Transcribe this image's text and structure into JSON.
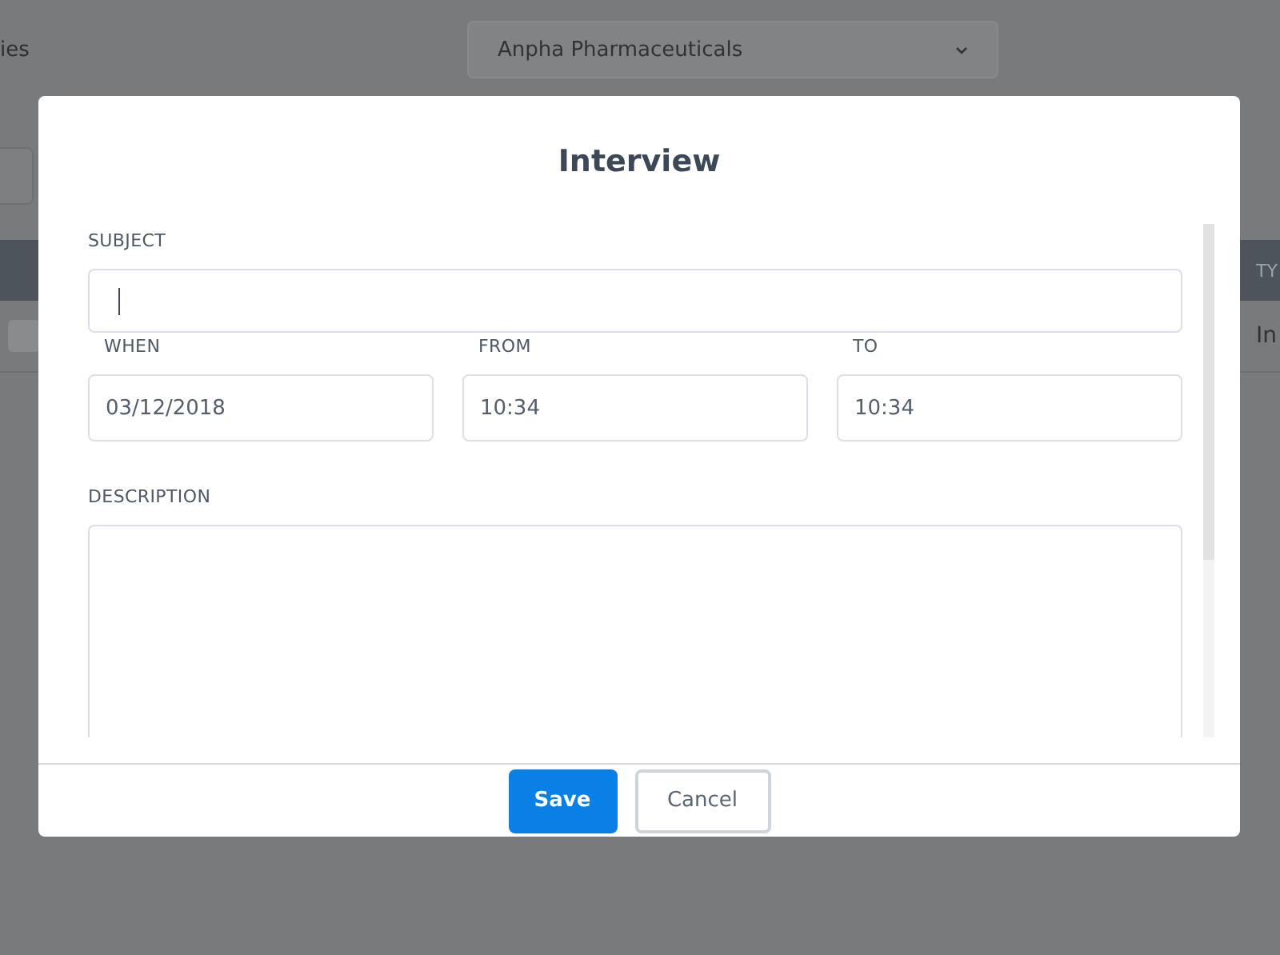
{
  "background": {
    "heading": "ies",
    "company_select": {
      "value": "Anpha Pharmaceuticals"
    },
    "column_header": "TY",
    "row_cell": "In"
  },
  "dialog": {
    "title": "Interview",
    "subject": {
      "label": "SUBJECT",
      "focused": true
    },
    "fields": [
      {
        "label": "WHEN",
        "value": "03/12/2018"
      },
      {
        "label": "FROM",
        "value": "10:34"
      },
      {
        "label": "TO",
        "value": "10:34"
      }
    ],
    "description": {
      "label": "DESCRIPTION"
    },
    "buttons": [
      {
        "label": "Save",
        "kind": "primary"
      },
      {
        "label": "Cancel",
        "kind": "secondary"
      }
    ]
  }
}
